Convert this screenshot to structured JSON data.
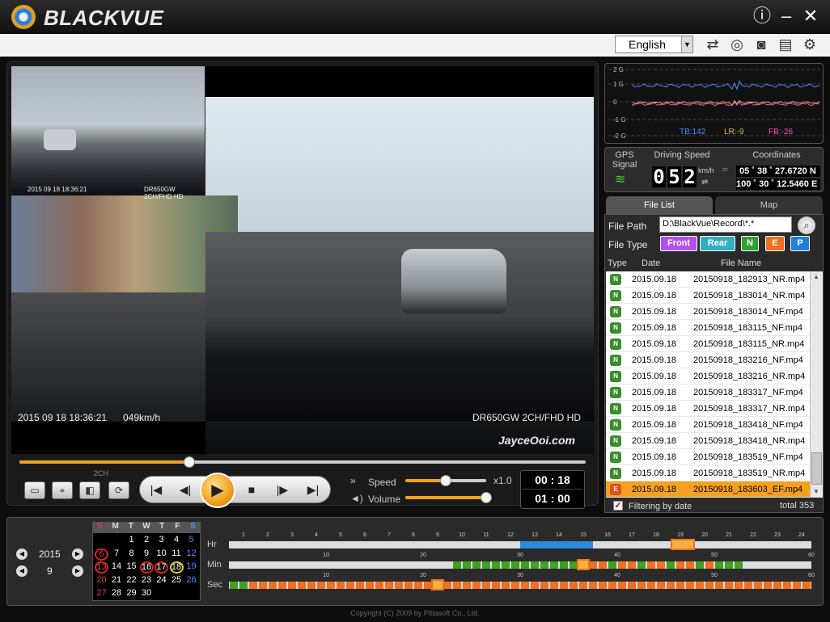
{
  "app": {
    "brand": "BLACKVUE"
  },
  "toolbar": {
    "language": "English",
    "icons": [
      "convert-icon",
      "map-icon",
      "camera-icon",
      "print-icon",
      "settings-icon"
    ]
  },
  "title_icons": [
    "info-icon",
    "minimize-icon",
    "close-icon"
  ],
  "video": {
    "osd_time": "2015 09 18   18:36:21",
    "osd_speed": "049km/h",
    "osd_model": "DR650GW 2CH/FHD HD",
    "rear_osd": "2015 09 18  18:36:21",
    "rear_model": "DR650GW 2CH/FHD HD",
    "watermark": "JayceOoi.com",
    "progress_fraction": 0.3
  },
  "controls": {
    "two_ch": "2CH",
    "speed_label": "Speed",
    "speed_value": "x1.0",
    "volume_label": "Volume",
    "speed_fraction": 0.5,
    "volume_fraction": 1.0,
    "elapsed": "00 : 18",
    "duration": "01 : 00"
  },
  "gsensor": {
    "levels": [
      "2 G",
      "1 G",
      "0",
      "-1 G",
      "-2 G"
    ],
    "tb": "TB:142",
    "lr": "LR:-9",
    "fb": "FB:-26",
    "colors": {
      "tb": "#4a8cff",
      "lr": "#e0c040",
      "fb": "#ff50c0"
    }
  },
  "gps": {
    "signal_label": "GPS\nSignal",
    "speed_label": "Driving Speed",
    "speed_digits": [
      "0",
      "5",
      "2"
    ],
    "speed_unit": "km/h",
    "coord_label": "Coordinates",
    "lat": "05 ˚  38 ˚ 27.6720 N",
    "lon": "100 ˚  30 ˚ 12.5460 E"
  },
  "tabs": {
    "file_list": "File List",
    "map": "Map"
  },
  "filepanel": {
    "path_label": "File Path",
    "path_value": "D:\\BlackVue\\Record\\*.*",
    "type_label": "File Type",
    "types": [
      {
        "label": "Front",
        "color": "#b050f0"
      },
      {
        "label": "Rear",
        "color": "#30b0c0"
      },
      {
        "label": "N",
        "color": "#30a030"
      },
      {
        "label": "E",
        "color": "#f07020"
      },
      {
        "label": "P",
        "color": "#2080e0"
      }
    ],
    "col_type": "Type",
    "col_date": "Date",
    "col_name": "File Name",
    "rows": [
      {
        "date": "2015.09.18",
        "name": "20150918_182913_NR.mp4"
      },
      {
        "date": "2015.09.18",
        "name": "20150918_183014_NR.mp4"
      },
      {
        "date": "2015.09.18",
        "name": "20150918_183014_NF.mp4"
      },
      {
        "date": "2015.09.18",
        "name": "20150918_183115_NF.mp4"
      },
      {
        "date": "2015.09.18",
        "name": "20150918_183115_NR.mp4"
      },
      {
        "date": "2015.09.18",
        "name": "20150918_183216_NF.mp4"
      },
      {
        "date": "2015.09.18",
        "name": "20150918_183216_NR.mp4"
      },
      {
        "date": "2015.09.18",
        "name": "20150918_183317_NF.mp4"
      },
      {
        "date": "2015.09.18",
        "name": "20150918_183317_NR.mp4"
      },
      {
        "date": "2015.09.18",
        "name": "20150918_183418_NF.mp4"
      },
      {
        "date": "2015.09.18",
        "name": "20150918_183418_NR.mp4"
      },
      {
        "date": "2015.09.18",
        "name": "20150918_183519_NF.mp4"
      },
      {
        "date": "2015.09.18",
        "name": "20150918_183519_NR.mp4"
      },
      {
        "date": "2015.09.18",
        "name": "20150918_183603_EF.mp4"
      }
    ],
    "filter_label": "Filtering by date",
    "total": "total  353"
  },
  "calendar": {
    "year": "2015",
    "month": "9",
    "days_header": [
      "S",
      "M",
      "T",
      "W",
      "T",
      "F",
      "S"
    ],
    "weeks": [
      [
        "",
        "",
        "1",
        "2",
        "3",
        "4",
        "5"
      ],
      [
        "6",
        "7",
        "8",
        "9",
        "10",
        "11",
        "12"
      ],
      [
        "13",
        "14",
        "15",
        "16",
        "17",
        "18",
        "19"
      ],
      [
        "20",
        "21",
        "22",
        "23",
        "24",
        "25",
        "26"
      ],
      [
        "27",
        "28",
        "29",
        "30",
        "",
        "",
        ""
      ]
    ],
    "recorded_days": [
      "6",
      "13",
      "16",
      "17"
    ],
    "selected_day": "18"
  },
  "timeline": {
    "hr_label": "Hr",
    "min_label": "Min",
    "sec_label": "Sec",
    "hr_ticks": [
      "1",
      "2",
      "3",
      "4",
      "5",
      "6",
      "7",
      "8",
      "9",
      "10",
      "11",
      "12",
      "13",
      "14",
      "15",
      "16",
      "17",
      "18",
      "19",
      "20",
      "21",
      "22",
      "23",
      "24"
    ],
    "min_ticks": [
      "10",
      "20",
      "30",
      "40",
      "50",
      "60"
    ],
    "sec_ticks": [
      "10",
      "20",
      "30",
      "40",
      "50",
      "60"
    ]
  },
  "copyright": "Copyright (C) 2009 by Pittasoft Co., Ltd."
}
